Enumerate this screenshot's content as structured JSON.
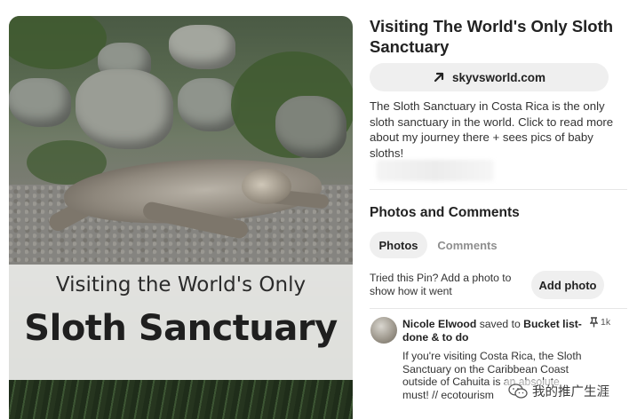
{
  "pin": {
    "title": "Visiting The World's Only Sloth Sanctuary",
    "link_label": "skyvsworld.com",
    "description": "The Sloth Sanctuary in Costa Rica is the only sloth sanctuary in the world. Click to read more about my journey there + sees pics of baby sloths!"
  },
  "image": {
    "overlay_line1": "Visiting the World's Only",
    "overlay_line2": "Sloth Sanctuary"
  },
  "section": {
    "title": "Photos and Comments",
    "tabs": [
      {
        "label": "Photos",
        "active": true
      },
      {
        "label": "Comments",
        "active": false
      }
    ],
    "tried_text": "Tried this Pin? Add a photo to show how it went",
    "add_photo_label": "Add photo"
  },
  "activity": {
    "user": "Nicole Elwood",
    "action": "saved to",
    "board": "Bucket list-done & to do",
    "pin_count": "1k",
    "text": "If you're visiting Costa Rica, the Sloth Sanctuary on the Caribbean Coast outside of Cahuita is an absolute must! // ecotourism"
  },
  "watermark": {
    "text": "我的推广生涯",
    "icon": "wechat-icon"
  },
  "icons": {
    "link": "arrow-up-right-icon",
    "pin": "pushpin-icon"
  },
  "colors": {
    "button_bg": "#efefef",
    "text": "#222222",
    "muted": "#8e8e8e"
  }
}
